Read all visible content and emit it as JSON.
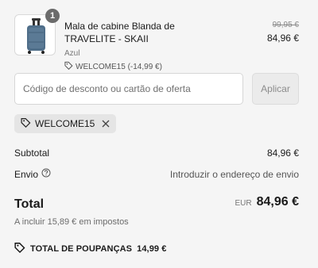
{
  "line_item": {
    "quantity": "1",
    "title": "Mala de cabine Blanda de TRAVELITE - SKAII",
    "variant": "Azul",
    "discount": "WELCOME15 (-14,99 €)",
    "price_original": "99,95 €",
    "price_final": "84,96 €",
    "product_color": "#4f6e89"
  },
  "discount_code": {
    "placeholder": "Código de desconto ou cartão de oferta",
    "apply_label": "Aplicar",
    "applied_code": "WELCOME15"
  },
  "summary": {
    "subtotal_label": "Subtotal",
    "subtotal_value": "84,96 €",
    "shipping_label": "Envio",
    "shipping_value": "Introduzir o endereço de envio",
    "total_label": "Total",
    "total_currency": "EUR",
    "total_value": "84,96 €",
    "tax_note": "A incluir 15,89 € em impostos",
    "savings_label": "TOTAL DE POUPANÇAS",
    "savings_value": "14,99 €"
  }
}
